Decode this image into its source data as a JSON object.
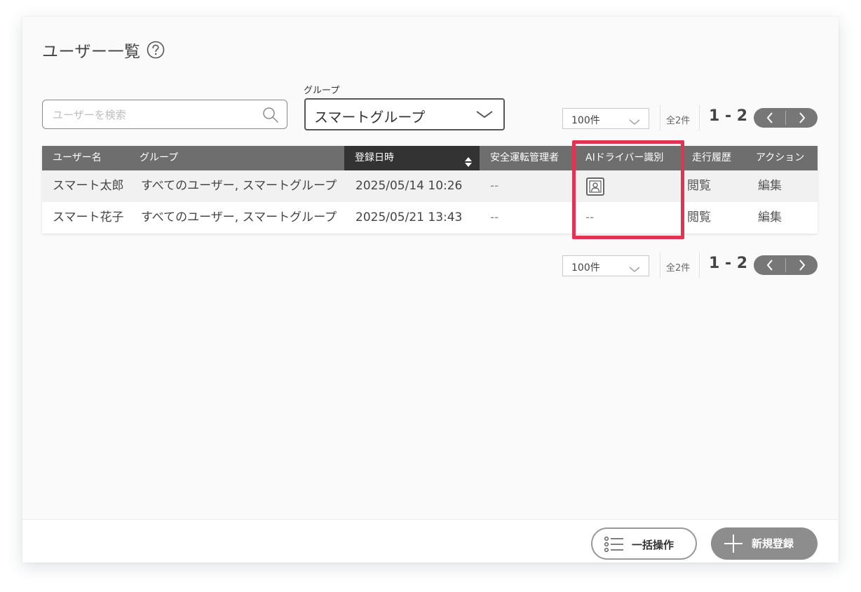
{
  "page": {
    "title": "ユーザー一覧"
  },
  "search": {
    "placeholder": "ユーザーを検索"
  },
  "group_filter": {
    "label": "グループ",
    "value": "スマートグループ"
  },
  "pagination_top": {
    "per_page": "100件",
    "total": "全2件",
    "range": "1 - 2"
  },
  "pagination_bottom": {
    "per_page": "100件",
    "total": "全2件",
    "range": "1 - 2"
  },
  "table": {
    "headers": [
      "ユーザー名",
      "グループ",
      "登録日時",
      "安全運転管理者",
      "AIドライバー識別",
      "走行履歴",
      "アクション"
    ],
    "rows": [
      {
        "name": "スマート太郎",
        "groups": "すべてのユーザー, スマートグループ",
        "registered": "2025/05/14 10:26",
        "safety_manager": "--",
        "ai_driver_id": "portrait-icon",
        "history": "閲覧",
        "action": "編集"
      },
      {
        "name": "スマート花子",
        "groups": "すべてのユーザー, スマートグループ",
        "registered": "2025/05/21 13:43",
        "safety_manager": "--",
        "ai_driver_id": "--",
        "history": "閲覧",
        "action": "編集"
      }
    ],
    "sorted_column": "登録日時"
  },
  "footer": {
    "bulk_label": "一括操作",
    "new_label": "新規登録"
  },
  "colors": {
    "highlight": "#e03452",
    "header_bg": "#6e6e6e",
    "sorted_header_bg": "#333333"
  }
}
